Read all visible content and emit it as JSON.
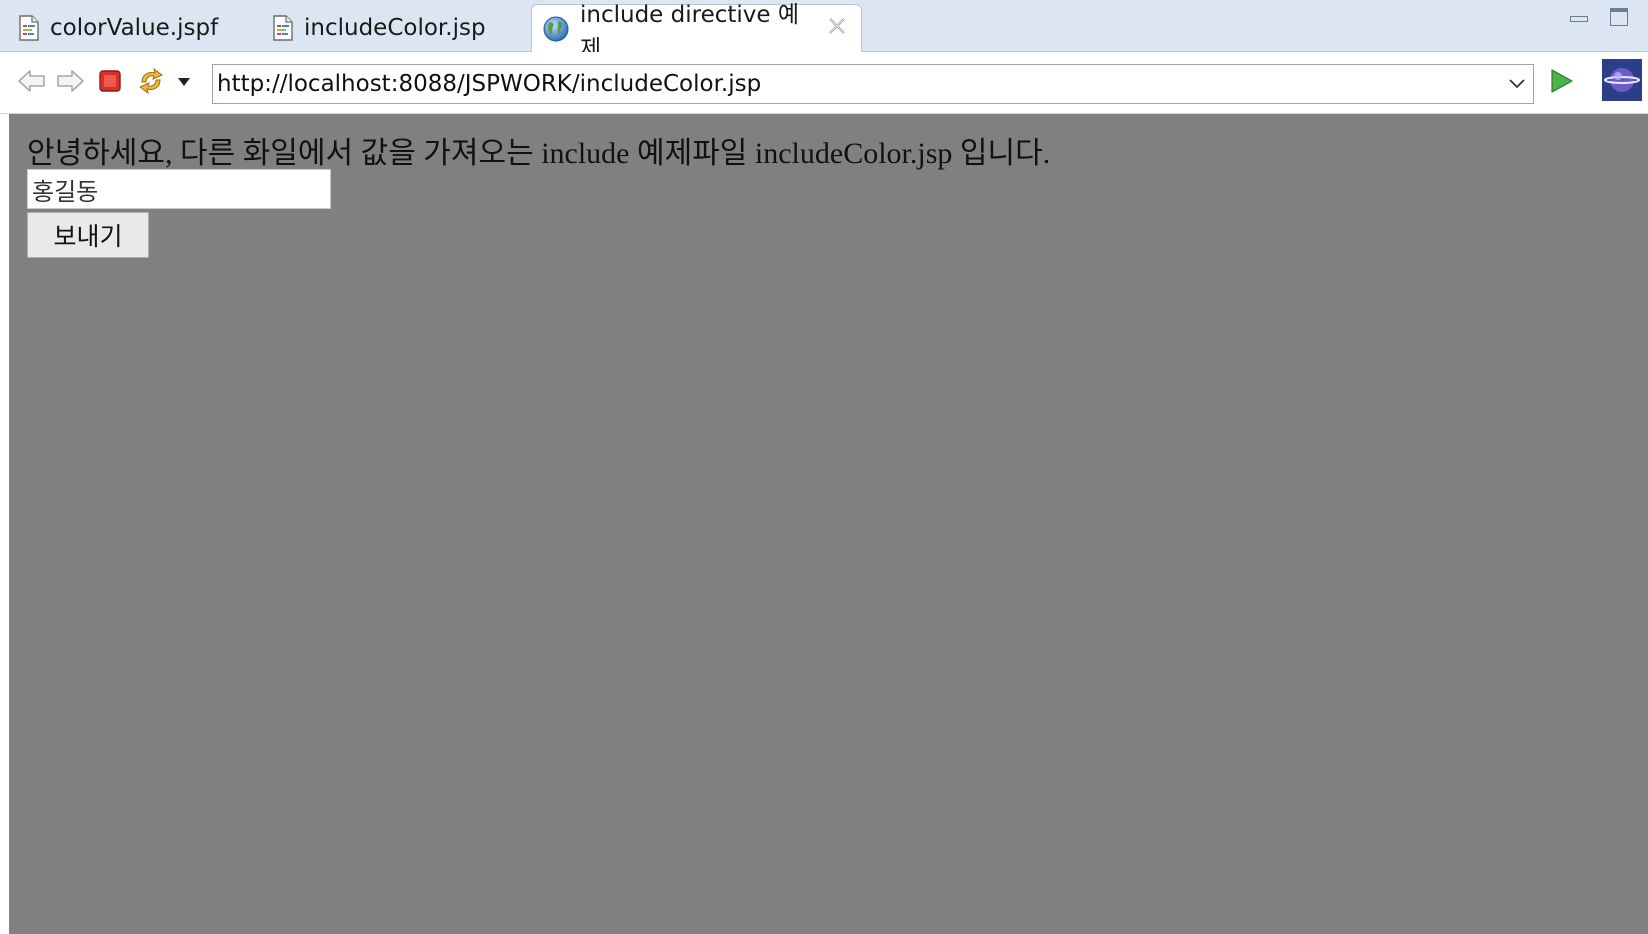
{
  "tabs": [
    {
      "label": "colorValue.jspf",
      "icon": "jsp-file-icon",
      "active": false
    },
    {
      "label": "includeColor.jsp",
      "icon": "jsp-file-icon",
      "active": false
    },
    {
      "label": "include directive 예제",
      "icon": "globe-icon",
      "active": true
    }
  ],
  "toolbar": {
    "url": "http://localhost:8088/JSPWORK/includeColor.jsp"
  },
  "page": {
    "message": "안녕하세요, 다른 화일에서 값을 가져오는 include 예제파일 includeColor.jsp 입니다.",
    "name_value": "홍길동",
    "send_label": "보내기",
    "background": "#808080"
  }
}
